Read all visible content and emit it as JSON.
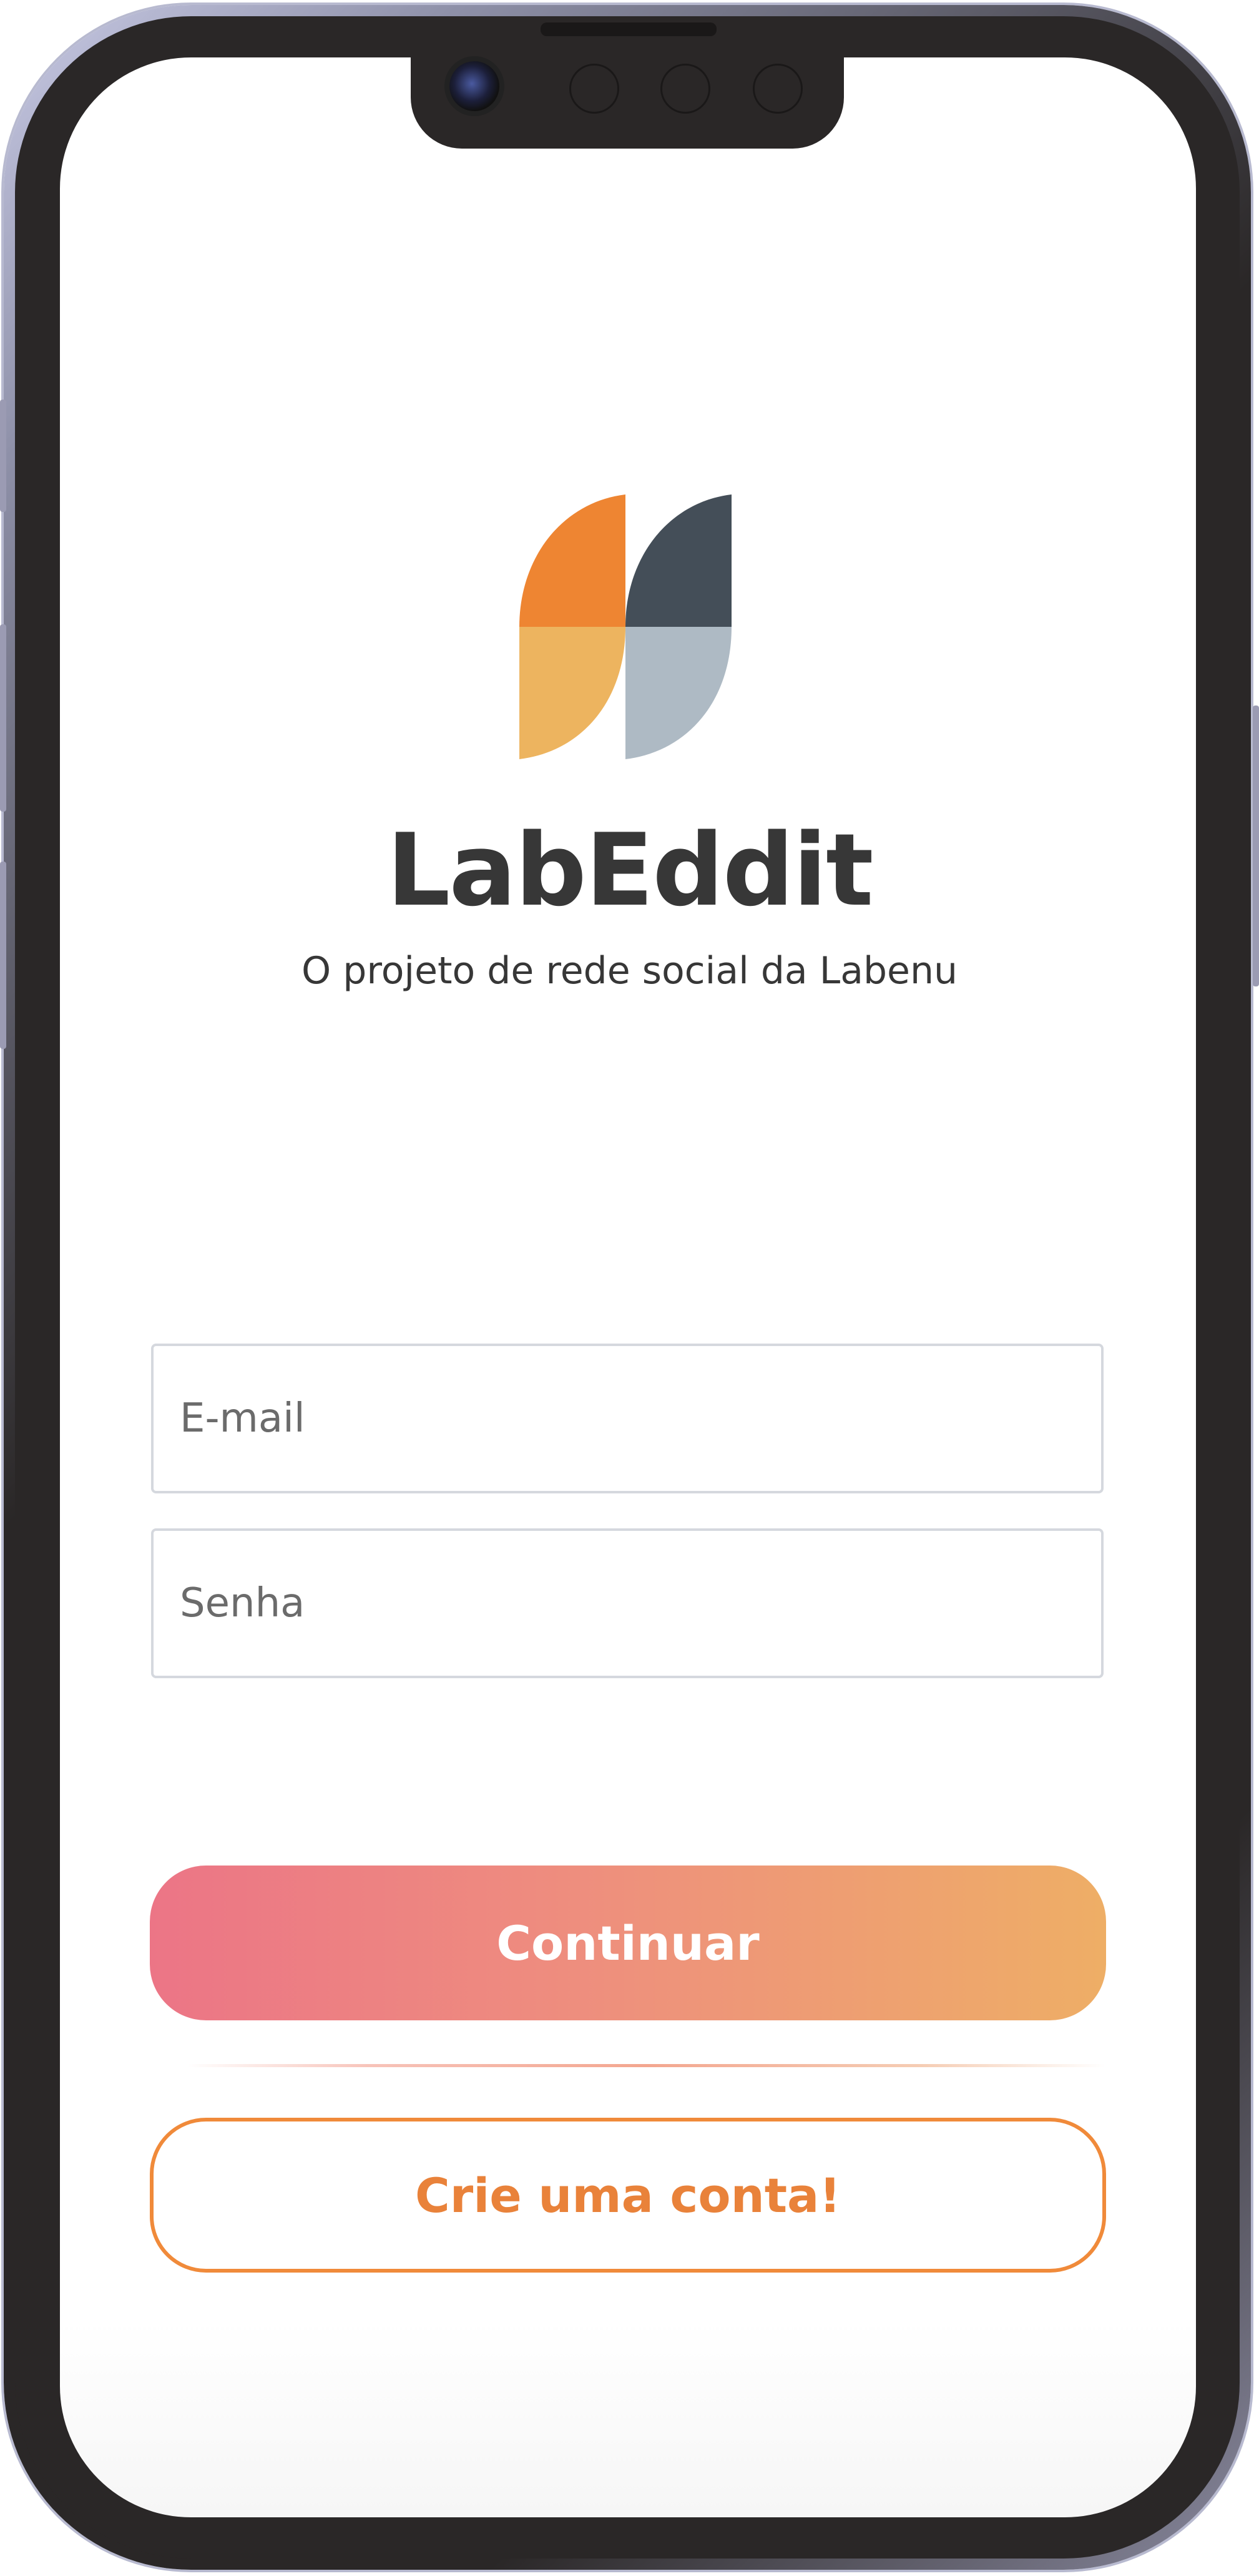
{
  "app": {
    "name": "LabEddit",
    "tagline": "O projeto de rede social da Labenu"
  },
  "form": {
    "email_placeholder": "E-mail",
    "password_placeholder": "Senha",
    "continue_label": "Continuar",
    "signup_label": "Crie uma conta!"
  },
  "colors": {
    "logo_orange_dark": "#ee8532",
    "logo_orange_light": "#edb45f",
    "logo_slate_dark": "#444e58",
    "logo_slate_light": "#aebac4",
    "text_dark": "#373737",
    "primary_gradient_start": "#ec7586",
    "primary_gradient_end": "#eeae66",
    "secondary_accent": "#f08a3a"
  },
  "icons": {
    "logo": "labeddit-logo-icon",
    "camera": "front-camera-icon"
  }
}
